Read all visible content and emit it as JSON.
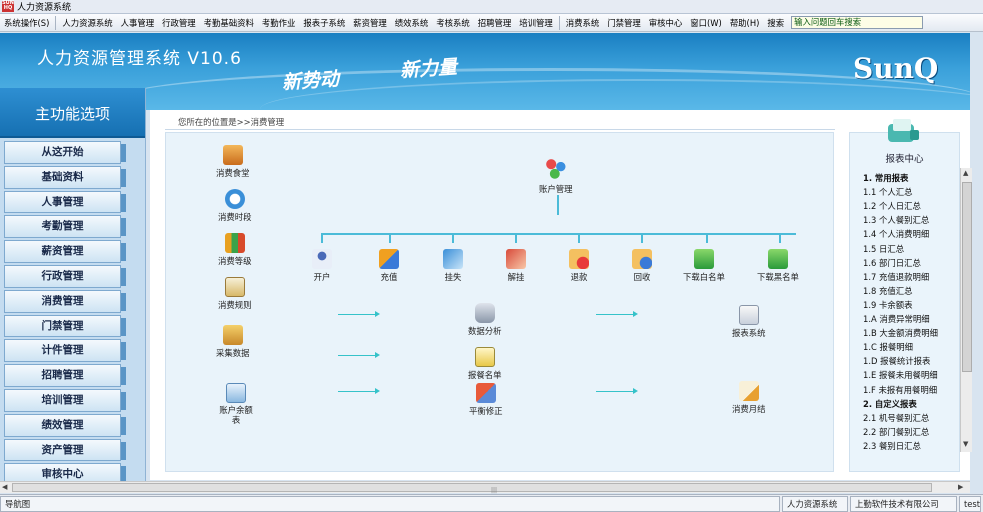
{
  "window": {
    "title": "人力资源系统"
  },
  "menu": {
    "items": [
      "系统操作(S)",
      "人力资源系统",
      "人事管理",
      "行政管理",
      "考勤基础资料",
      "考勤作业",
      "报表子系统",
      "薪资管理",
      "绩效系统",
      "考核系统",
      "招聘管理",
      "培训管理",
      "消费系统",
      "门禁管理",
      "审核中心",
      "窗口(W)",
      "帮助(H)",
      "搜索"
    ],
    "search_value": "输入问题回车搜索"
  },
  "banner": {
    "title": "人力资源管理系统 V10.6",
    "slogan1": "新势动",
    "slogan2": "新力量",
    "logo": "SunQ"
  },
  "sidebar": {
    "heading": "主功能选项",
    "items": [
      "从这开始",
      "基础资料",
      "人事管理",
      "考勤管理",
      "薪资管理",
      "行政管理",
      "消费管理",
      "门禁管理",
      "计件管理",
      "招聘管理",
      "培训管理",
      "绩效管理",
      "资产管理",
      "审核中心"
    ]
  },
  "breadcrumb": "您所在的位置是>>消费管理",
  "workflow": {
    "left": [
      "消费食堂",
      "消费时段",
      "消费等级",
      "消费规则",
      "采集数据",
      "账户余额表"
    ],
    "top": "账户管理",
    "row": [
      "开户",
      "充值",
      "挂失",
      "解挂",
      "退款",
      "回收",
      "下载白名单",
      "下载黑名单"
    ],
    "center": [
      "数据分析",
      "报餐名单",
      "平衡修正"
    ],
    "right": [
      "报表系统",
      "消费月结"
    ]
  },
  "report_center": {
    "title": "报表中心",
    "items": [
      {
        "text": "1. 常用报表",
        "head": true
      },
      {
        "text": "1.1 个人汇总"
      },
      {
        "text": "1.2 个人日汇总"
      },
      {
        "text": "1.3 个人餐别汇总"
      },
      {
        "text": "1.4 个人消费明细"
      },
      {
        "text": "1.5 日汇总"
      },
      {
        "text": "1.6 部门日汇总"
      },
      {
        "text": "1.7 充值退款明细"
      },
      {
        "text": "1.8 充值汇总"
      },
      {
        "text": "1.9 卡余额表"
      },
      {
        "text": "1.A 消费异常明细"
      },
      {
        "text": "1.B 大金额消费明细"
      },
      {
        "text": "1.C 报餐明细"
      },
      {
        "text": "1.D 报餐统计报表"
      },
      {
        "text": "1.E 报餐未用餐明细"
      },
      {
        "text": "1.F 未报有用餐明细"
      },
      {
        "text": "2. 自定义报表",
        "head": true
      },
      {
        "text": "2.1 机号餐别汇总"
      },
      {
        "text": "2.2 部门餐别汇总"
      },
      {
        "text": "2.3 餐别日汇总"
      }
    ]
  },
  "status": {
    "left": "导航图",
    "system": "人力资源系统",
    "company": "上勤软件技术有限公司",
    "user": "test"
  }
}
